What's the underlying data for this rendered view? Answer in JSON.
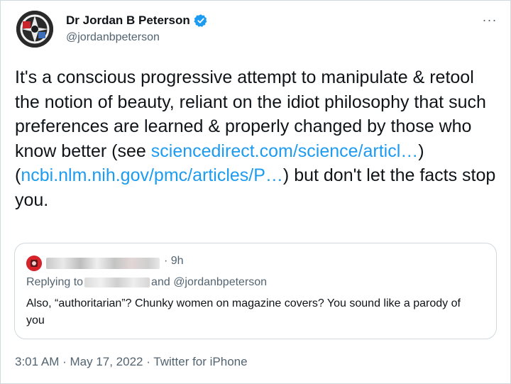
{
  "author": {
    "name": "Dr Jordan B Peterson",
    "handle": "@jordanbpeterson",
    "verified": true,
    "avatar_icon": "avatar-image"
  },
  "more_label": "···",
  "tweet": {
    "segments": [
      "It's a conscious progressive attempt to manipulate & retool the notion of beauty, reliant on the idiot philosophy that such preferences are learned & properly changed by those who know better (see ",
      "sciencedirect.com/science/articl…",
      ") (",
      "ncbi.nlm.nih.gov/pmc/articles/P…",
      ") but don't let the facts stop you."
    ]
  },
  "quote": {
    "time": "· 9h",
    "replying_prefix": "Replying to",
    "replying_suffix": "and @jordanbpeterson",
    "text": "Also, “authoritarian”? Chunky women on magazine covers? You sound like a parody of you"
  },
  "meta": {
    "time": "3:01 AM · May 17, 2022 · Twitter for iPhone"
  },
  "colors": {
    "link": "#1d9bf0",
    "secondary_text": "#536471",
    "verified_badge": "#1d9bf0"
  }
}
